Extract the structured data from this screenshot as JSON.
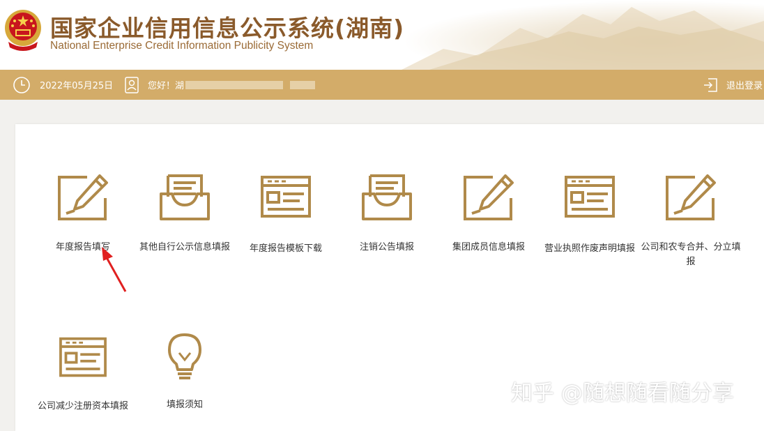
{
  "header": {
    "title_cn": "国家企业信用信息公示系统(湖南)",
    "title_en": "National Enterprise Credit Information Publicity System"
  },
  "infobar": {
    "date": "2022年05月25日",
    "greeting": "您好！湖",
    "logout": "退出登录"
  },
  "tiles": [
    {
      "label": "年度报告填写",
      "icon": "edit-pencil-icon"
    },
    {
      "label": "其他自行公示信息填报",
      "icon": "inbox-tray-icon"
    },
    {
      "label": "年度报告模板下载",
      "icon": "form-template-icon"
    },
    {
      "label": "注销公告填报",
      "icon": "inbox-tray-icon"
    },
    {
      "label": "集团成员信息填报",
      "icon": "edit-pencil-icon"
    },
    {
      "label": "营业执照作废声明填报",
      "icon": "form-template-icon"
    },
    {
      "label": "公司和农专合并、分立填报",
      "icon": "edit-pencil-icon"
    },
    {
      "label": "公司减少注册资本填报",
      "icon": "form-template-icon"
    },
    {
      "label": "填报须知",
      "icon": "lightbulb-icon"
    }
  ],
  "watermark": "知乎 @随想随看随分享",
  "colors": {
    "gold": "#d3ac69",
    "icon": "#b08a4a",
    "title": "#8a5a2b",
    "arrow": "#e02020"
  }
}
